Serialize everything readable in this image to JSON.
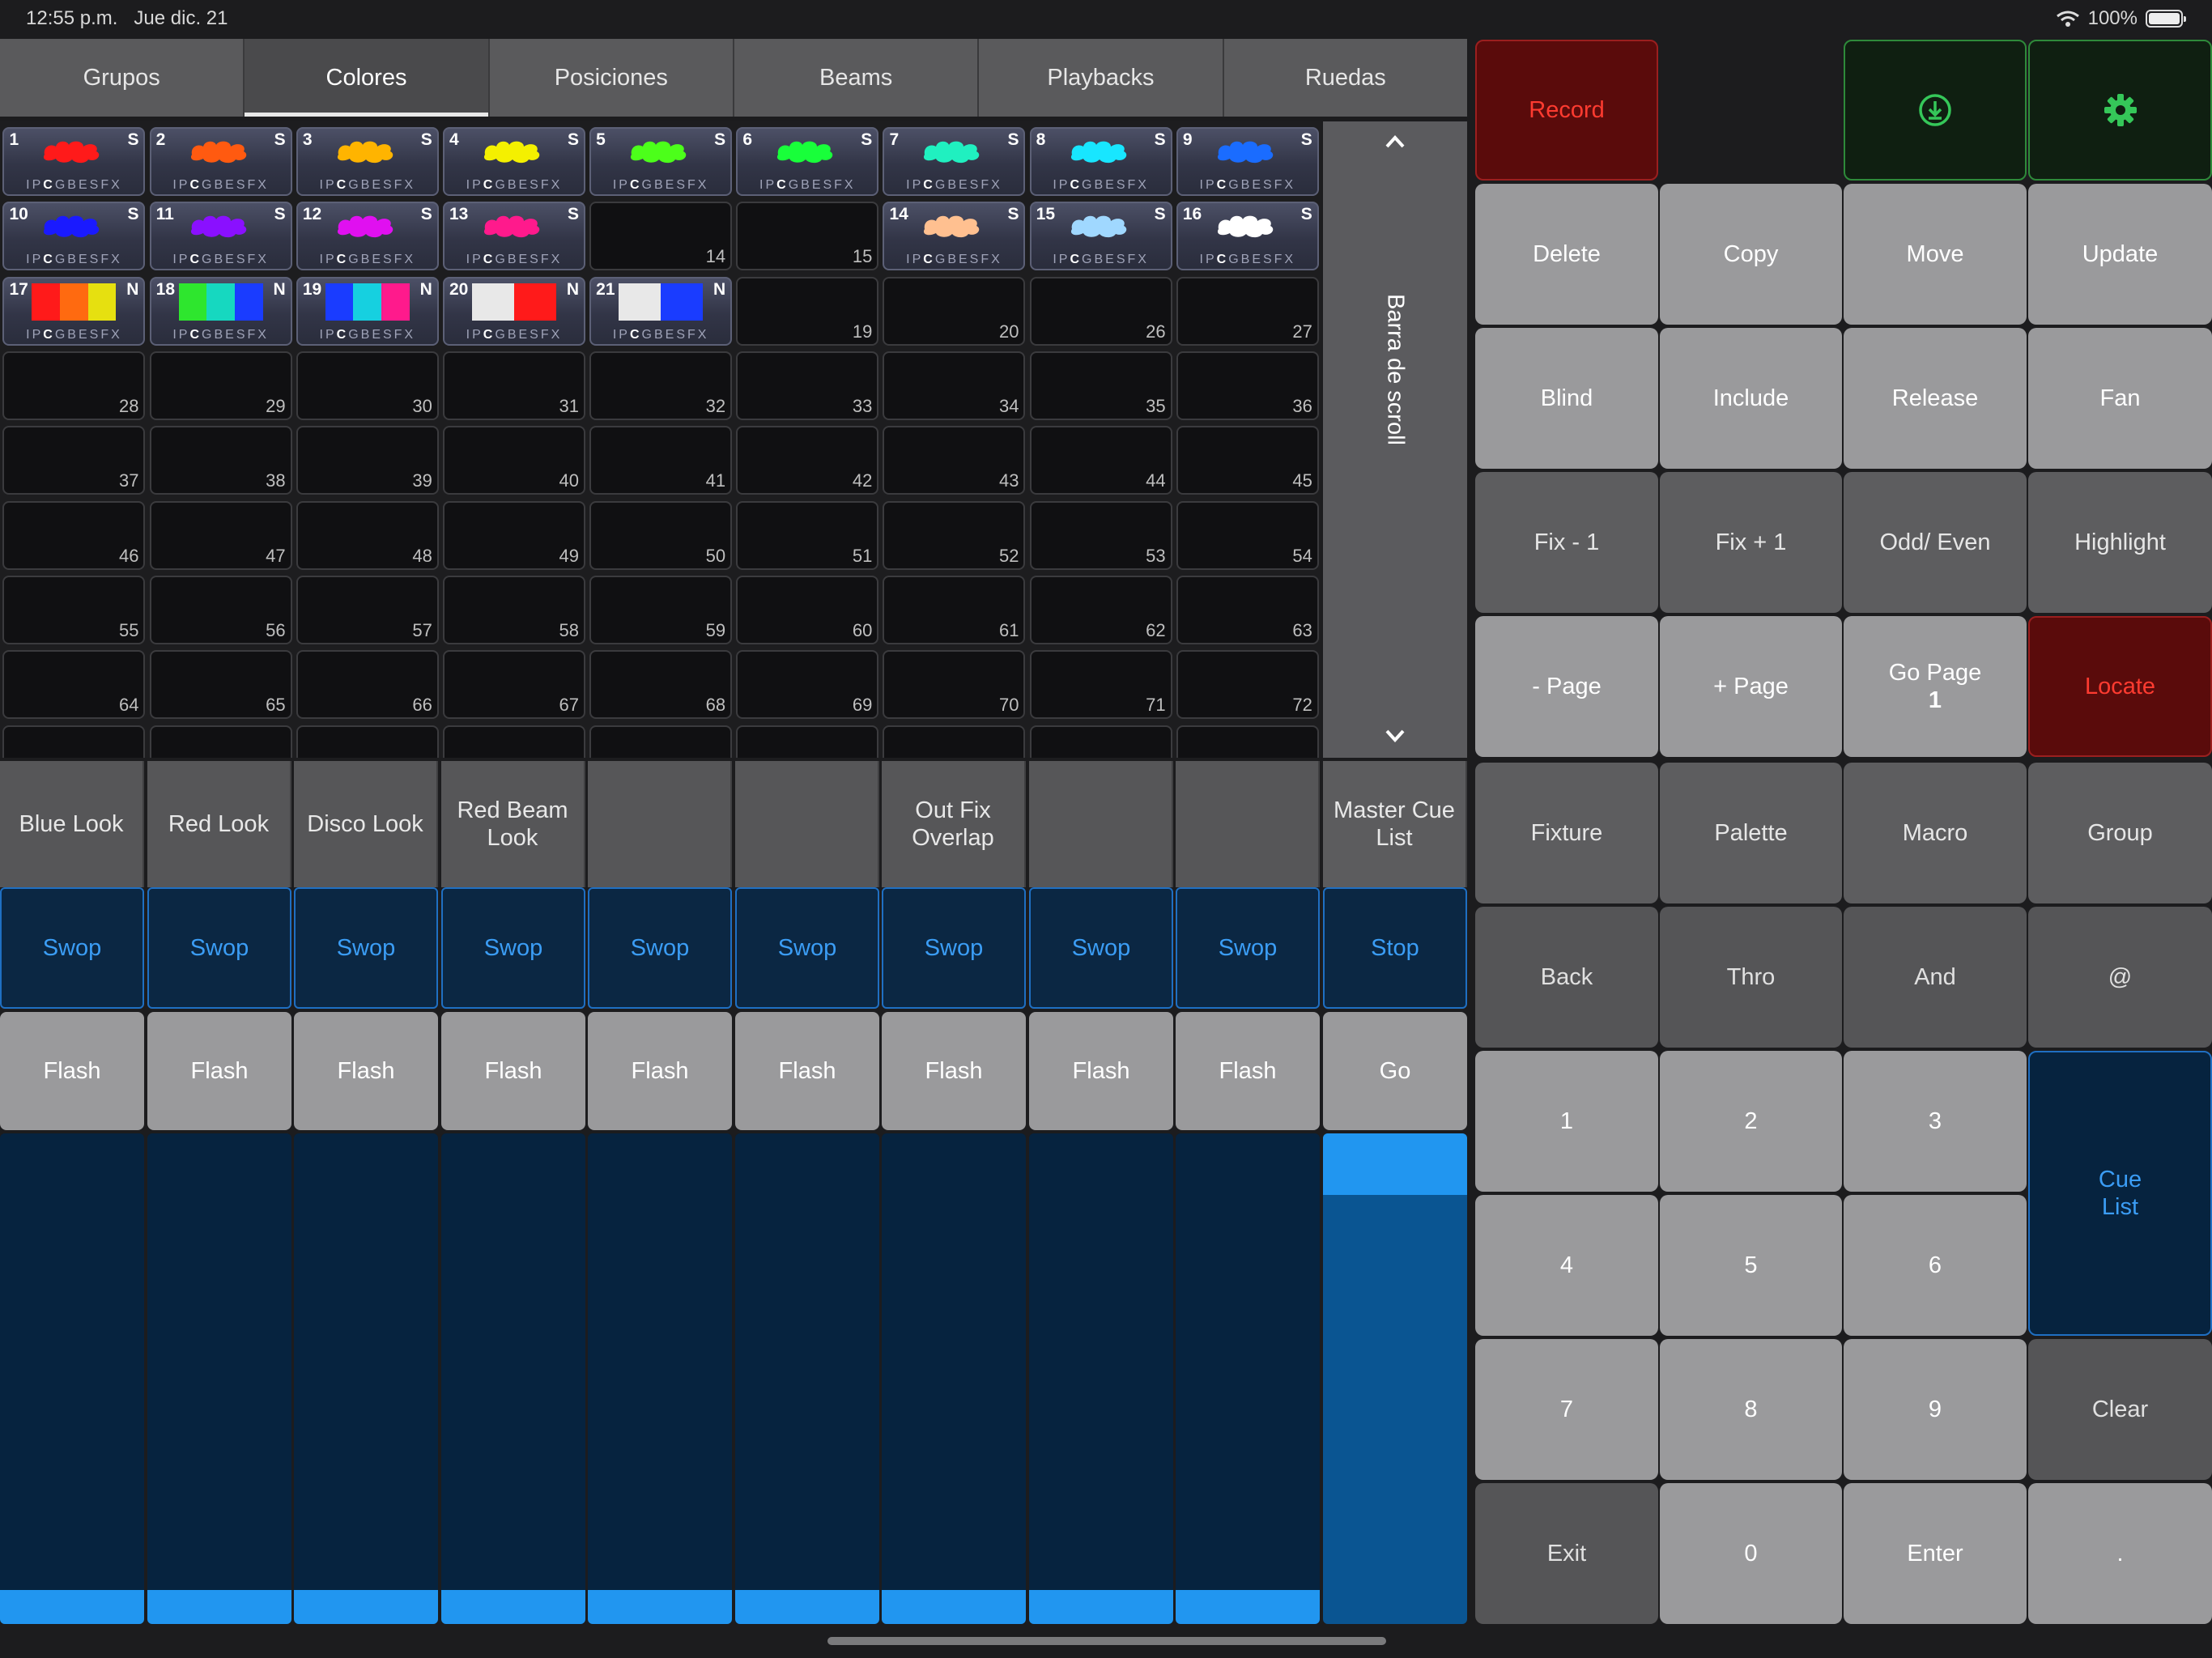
{
  "status": {
    "time": "12:55 p.m.",
    "date": "Jue dic. 21",
    "battery": "100%"
  },
  "tabs": [
    {
      "label": "Grupos",
      "active": false
    },
    {
      "label": "Colores",
      "active": true
    },
    {
      "label": "Posiciones",
      "active": false
    },
    {
      "label": "Beams",
      "active": false
    },
    {
      "label": "Playbacks",
      "active": false
    },
    {
      "label": "Ruedas",
      "active": false
    }
  ],
  "palette_attr_letters": [
    "I",
    "P",
    "C",
    "G",
    "B",
    "E",
    "S",
    "FX"
  ],
  "palettes": [
    {
      "n": "1",
      "flag": "S",
      "colors": [
        "#ff1a1a"
      ]
    },
    {
      "n": "2",
      "flag": "S",
      "colors": [
        "#ff5a10"
      ]
    },
    {
      "n": "3",
      "flag": "S",
      "colors": [
        "#ffb400"
      ]
    },
    {
      "n": "4",
      "flag": "S",
      "colors": [
        "#f4f000"
      ]
    },
    {
      "n": "5",
      "flag": "S",
      "colors": [
        "#4cff1a"
      ]
    },
    {
      "n": "6",
      "flag": "S",
      "colors": [
        "#18ff3a"
      ]
    },
    {
      "n": "7",
      "flag": "S",
      "colors": [
        "#20f0c0"
      ]
    },
    {
      "n": "8",
      "flag": "S",
      "colors": [
        "#18e6ff"
      ]
    },
    {
      "n": "9",
      "flag": "S",
      "colors": [
        "#1a6cff"
      ]
    },
    {
      "n": "10",
      "flag": "S",
      "colors": [
        "#1a1aff"
      ]
    },
    {
      "n": "11",
      "flag": "S",
      "colors": [
        "#8a10ff"
      ]
    },
    {
      "n": "12",
      "flag": "S",
      "colors": [
        "#e010f0"
      ]
    },
    {
      "n": "13",
      "flag": "S",
      "colors": [
        "#ff1a8c"
      ]
    },
    null,
    null,
    {
      "n": "14",
      "flag": "S",
      "colors": [
        "#ffc090"
      ]
    },
    {
      "n": "15",
      "flag": "S",
      "colors": [
        "#a0d8ff"
      ]
    },
    {
      "n": "16",
      "flag": "S",
      "colors": [
        "#ffffff"
      ]
    },
    {
      "n": "17",
      "flag": "N",
      "colors": [
        "#ff1a1a",
        "#ff6a10",
        "#e6e010"
      ]
    },
    {
      "n": "18",
      "flag": "N",
      "colors": [
        "#2ee62e",
        "#16d8c0",
        "#1a3cff"
      ]
    },
    {
      "n": "19",
      "flag": "N",
      "colors": [
        "#1a3cff",
        "#16d0e0",
        "#ff1a8c"
      ]
    },
    {
      "n": "20",
      "flag": "N",
      "colors": [
        "#e8e8e8",
        "#ff1a1a"
      ]
    },
    {
      "n": "21",
      "flag": "N",
      "colors": [
        "#e8e8e8",
        "#1a3cff"
      ]
    }
  ],
  "empty_slot_numbers": [
    "14",
    "15",
    "19",
    "20",
    "26",
    "27",
    "28",
    "29",
    "30",
    "31",
    "32",
    "33",
    "34",
    "35",
    "36",
    "37",
    "38",
    "39",
    "40",
    "41",
    "42",
    "43",
    "44",
    "45",
    "46",
    "47",
    "48",
    "49",
    "50",
    "51",
    "52",
    "53",
    "54",
    "55",
    "56",
    "57",
    "58",
    "59",
    "60",
    "61",
    "62",
    "63",
    "64",
    "65",
    "66",
    "67",
    "68",
    "69",
    "70",
    "71",
    "72"
  ],
  "scrollbar": {
    "label": "Barra de scroll"
  },
  "playbacks": [
    {
      "name": "Blue Look",
      "swop": "Swop",
      "flash": "Flash",
      "level": 0.07
    },
    {
      "name": "Red Look",
      "swop": "Swop",
      "flash": "Flash",
      "level": 0.07
    },
    {
      "name": "Disco Look",
      "swop": "Swop",
      "flash": "Flash",
      "level": 0.07
    },
    {
      "name": "Red Beam Look",
      "swop": "Swop",
      "flash": "Flash",
      "level": 0.07
    },
    {
      "name": "",
      "swop": "Swop",
      "flash": "Flash",
      "level": 0.07
    },
    {
      "name": "",
      "swop": "Swop",
      "flash": "Flash",
      "level": 0.07
    },
    {
      "name": "Out Fix Overlap",
      "swop": "Swop",
      "flash": "Flash",
      "level": 0.07
    },
    {
      "name": "",
      "swop": "Swop",
      "flash": "Flash",
      "level": 0.07
    },
    {
      "name": "",
      "swop": "Swop",
      "flash": "Flash",
      "level": 0.07
    }
  ],
  "master": {
    "name": "Master Cue List",
    "stop": "Stop",
    "go": "Go",
    "level": 1.0
  },
  "keypad": {
    "record": "Record",
    "delete": "Delete",
    "copy": "Copy",
    "move": "Move",
    "update": "Update",
    "blind": "Blind",
    "include": "Include",
    "release": "Release",
    "fan": "Fan",
    "fix_minus": "Fix - 1",
    "fix_plus": "Fix + 1",
    "odd_even": "Odd/ Even",
    "highlight": "Highlight",
    "page_minus": "- Page",
    "page_plus": "+ Page",
    "go_page": "Go Page",
    "go_page_num": "1",
    "locate": "Locate",
    "fixture": "Fixture",
    "palette": "Palette",
    "macro": "Macro",
    "group": "Group",
    "back": "Back",
    "thro": "Thro",
    "and": "And",
    "at": "@",
    "d1": "1",
    "d2": "2",
    "d3": "3",
    "cue_list": "Cue List",
    "d4": "4",
    "d5": "5",
    "d6": "6",
    "d7": "7",
    "d8": "8",
    "d9": "9",
    "clear": "Clear",
    "exit": "Exit",
    "d0": "0",
    "enter": "Enter",
    "dot": "."
  },
  "colors": {
    "accent_blue": "#2196f0",
    "record_red": "#ff3b30",
    "green": "#35c759"
  }
}
